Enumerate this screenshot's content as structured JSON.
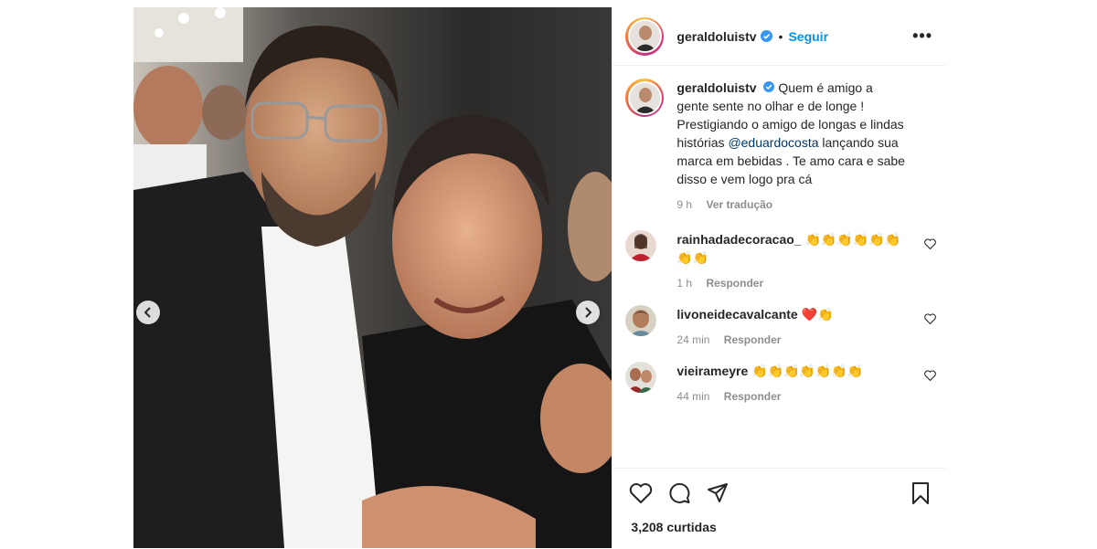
{
  "header": {
    "username": "geraldoluistv",
    "dot": "•",
    "follow_label": "Seguir",
    "more_label": "•••"
  },
  "caption": {
    "username": "geraldoluistv",
    "text_before": "Quem é amigo a gente sente no olhar e de longe ! Prestigiando o amigo de longas e lindas histórias",
    "mention": "@eduardocosta",
    "text_after": "lançando sua marca em bebidas . Te amo cara e sabe disso e vem logo pra cá",
    "time": "9 h",
    "translate_label": "Ver tradução"
  },
  "comments": [
    {
      "username": "rainhadadecoracao_",
      "text": "👏👏👏👏👏👏👏👏",
      "time": "1 h",
      "reply_label": "Responder"
    },
    {
      "username": "livoneidecavalcante",
      "text": "❤️👏",
      "time": "24 min",
      "reply_label": "Responder"
    },
    {
      "username": "vieirameyre",
      "text": "👏👏👏👏👏👏👏",
      "time": "44 min",
      "reply_label": "Responder"
    }
  ],
  "actions": {
    "likes": "3,208 curtidas",
    "icons": [
      "heart-icon",
      "comment-icon",
      "share-icon",
      "bookmark-icon"
    ]
  },
  "colors": {
    "accent": "#0095f6",
    "text": "#262626",
    "secondary": "#8e8e8e",
    "mention": "#00376b",
    "verified": "#3897f0"
  }
}
